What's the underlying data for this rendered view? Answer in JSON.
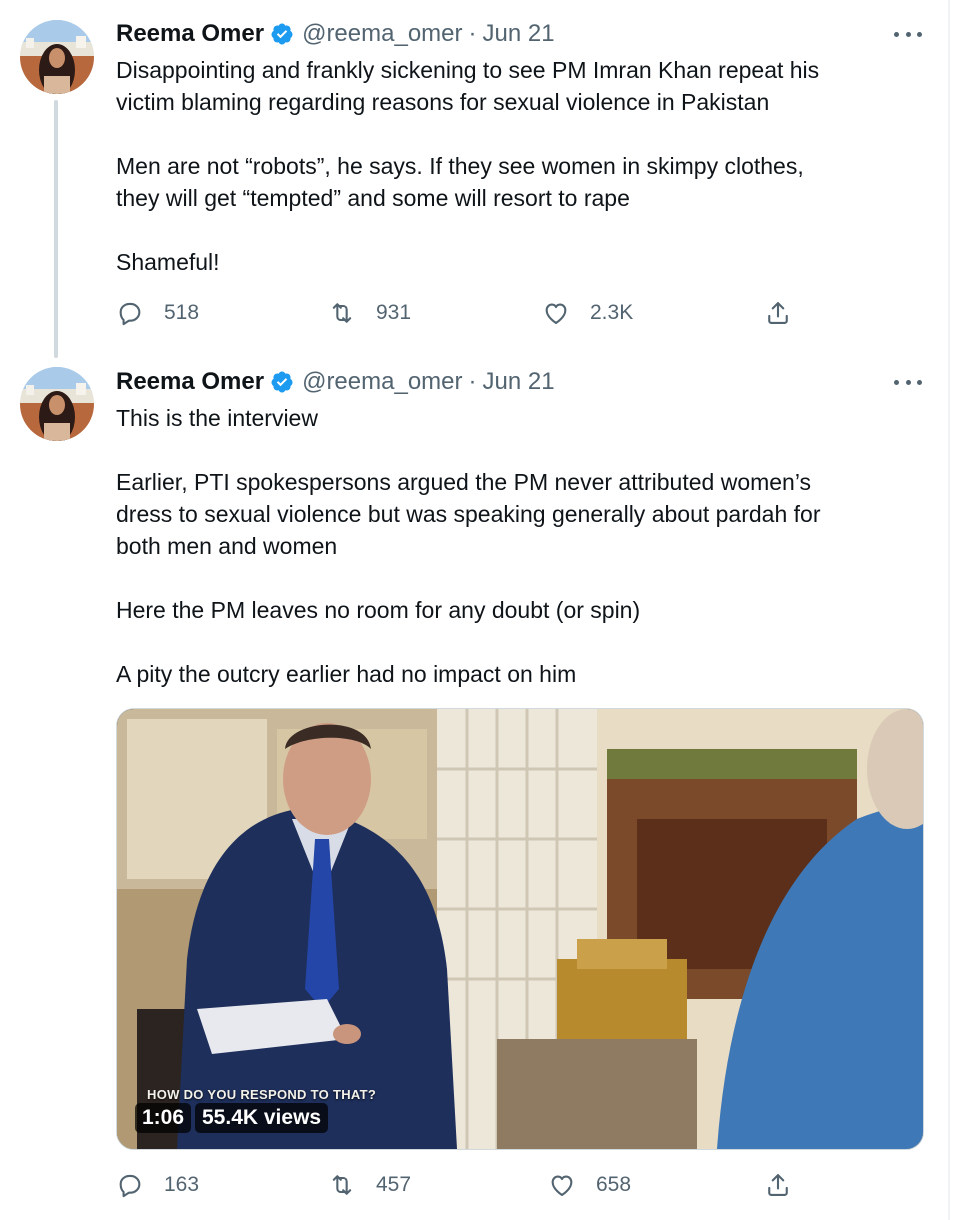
{
  "tweets": [
    {
      "author": {
        "name": "Reema Omer",
        "handle": "@reema_omer",
        "verified": true
      },
      "separator": "·",
      "date": "Jun 21",
      "paragraphs": [
        "Disappointing and frankly sickening to see PM Imran Khan repeat his\nvictim blaming regarding reasons for sexual violence in Pakistan",
        "Men are not “robots”, he says. If they see women in skimpy clothes,\nthey will get “tempted” and some will resort to rape",
        "Shameful!"
      ],
      "stats": {
        "replies": "518",
        "retweets": "931",
        "likes": "2.3K"
      }
    },
    {
      "author": {
        "name": "Reema Omer",
        "handle": "@reema_omer",
        "verified": true
      },
      "separator": "·",
      "date": "Jun 21",
      "paragraphs": [
        "This is the interview",
        "Earlier, PTI spokespersons argued the PM never attributed women’s\ndress to sexual violence but was speaking generally about pardah for\nboth men and women",
        "Here the PM leaves no room for any doubt (or spin)",
        "A pity the outcry earlier had no impact on him"
      ],
      "video": {
        "caption": "HOW DO YOU RESPOND TO THAT?",
        "duration": "1:06",
        "views": "55.4K views"
      },
      "stats": {
        "replies": "163",
        "retweets": "457",
        "likes": "658"
      }
    }
  ],
  "icons": {
    "reply": "speech-bubble-icon",
    "retweet": "retweet-arrows-icon",
    "like": "heart-outline-icon",
    "share": "share-upload-icon",
    "more": "three-dots-icon",
    "verified": "verified-badge-icon"
  },
  "colors": {
    "text": "#0f1419",
    "secondary": "#536471",
    "verified": "#1d9bf0",
    "thread_line": "#cfd9de"
  }
}
